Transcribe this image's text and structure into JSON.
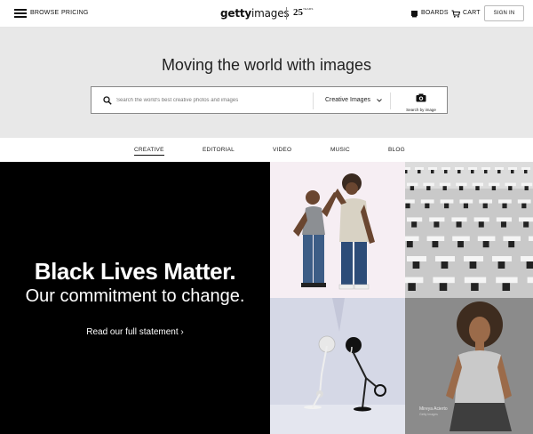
{
  "nav": {
    "browse": "BROWSE",
    "pricing": "PRICING",
    "logo_main": "getty",
    "logo_sub": "images",
    "anniversary": "25",
    "anniversary_sub": "YEARS",
    "boards": "BOARDS",
    "cart": "CART",
    "signin": "SIGN IN"
  },
  "hero": {
    "title": "Moving the world with images",
    "search_placeholder": "Search the world's best creative photos and images",
    "filter_label": "Creative Images",
    "search_by_image": "Search by image"
  },
  "tabs": [
    {
      "label": "CREATIVE",
      "active": true
    },
    {
      "label": "EDITORIAL",
      "active": false
    },
    {
      "label": "VIDEO",
      "active": false
    },
    {
      "label": "MUSIC",
      "active": false
    },
    {
      "label": "BLOG",
      "active": false
    }
  ],
  "banner": {
    "headline": "Black Lives Matter.",
    "subheadline": "Our commitment to change.",
    "link": "Read our full statement ›",
    "photo_caption": "Mireya Acierto",
    "photo_caption_sub": "Getty Images"
  },
  "colors": {
    "hero_bg": "#e8e8e8",
    "banner_bg": "#000000",
    "accent": "#111111"
  }
}
